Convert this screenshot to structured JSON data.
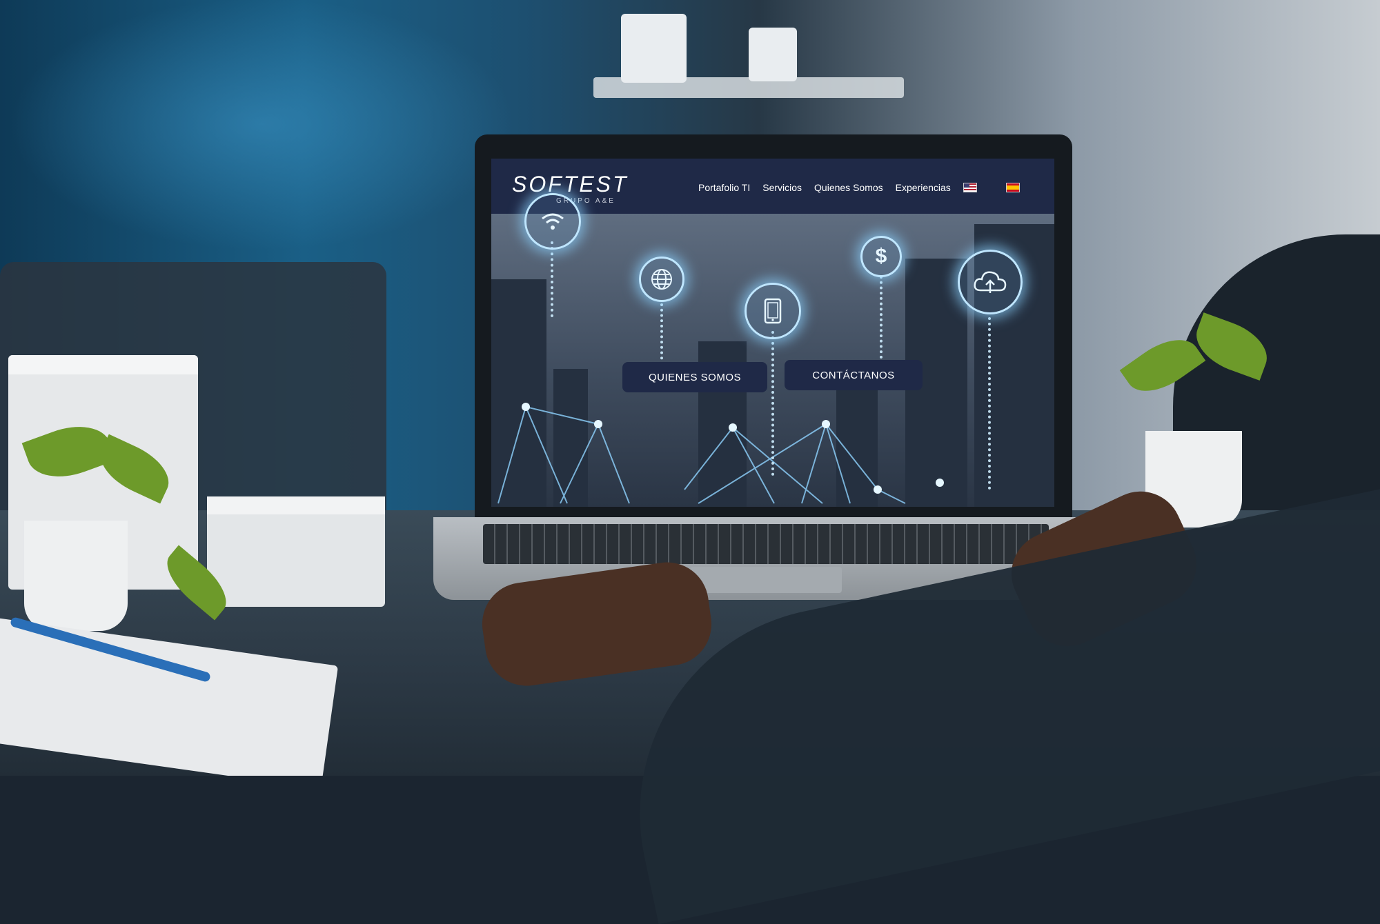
{
  "site": {
    "logo": {
      "name": "SOFTEST",
      "tagline": "GRUPO A&E"
    },
    "nav": {
      "items": [
        "Portafolio TI",
        "Servicios",
        "Quienes Somos",
        "Experiencias"
      ],
      "languages": [
        "en-flag",
        "es-flag"
      ]
    },
    "hero": {
      "buttons": [
        "QUIENES SOMOS",
        "CONTÁCTANOS"
      ],
      "icons": [
        "wifi-icon",
        "globe-icon",
        "tablet-icon",
        "dollar-icon",
        "cloud-upload-icon"
      ],
      "dollar_symbol": "$"
    }
  },
  "colors": {
    "header_bg": "#1f2947",
    "button_bg": "#1f2947",
    "glow": "#bfe6ff"
  }
}
